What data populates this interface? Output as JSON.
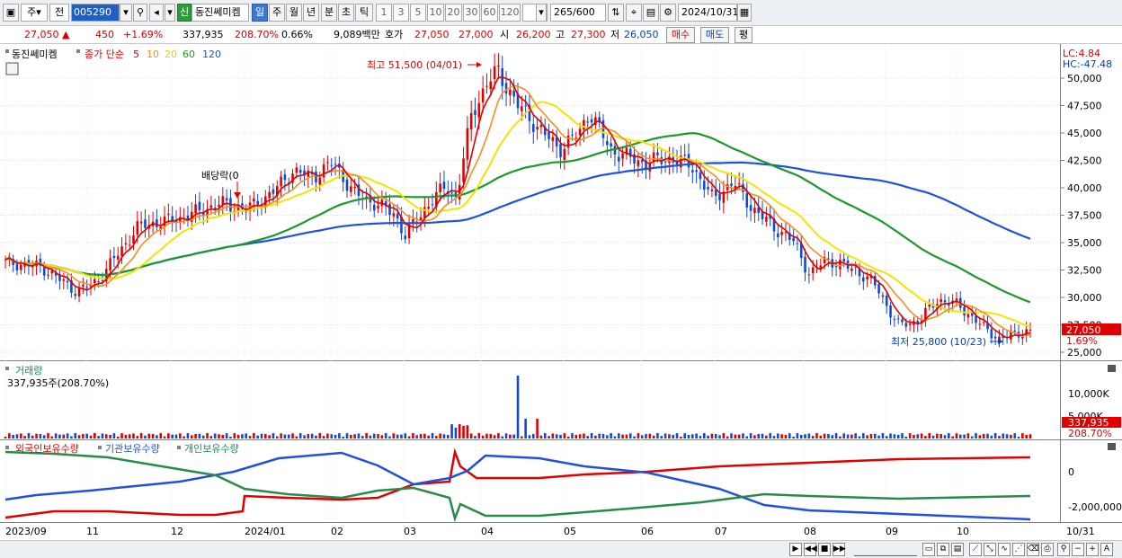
{
  "toolbar": {
    "period_main": "주",
    "period_prev": "전",
    "code": "005290",
    "credit_badge": "신",
    "stock_name": "동진쎄미켐",
    "periods": [
      "일",
      "주",
      "월",
      "년",
      "분",
      "초",
      "틱"
    ],
    "active_period": "일",
    "intervals": [
      "1",
      "3",
      "5",
      "10",
      "20",
      "30",
      "60",
      "120"
    ],
    "count": "265",
    "count_total": "/600",
    "date": "2024/10/31"
  },
  "quote": {
    "price": "27,050",
    "change": "450",
    "change_rate": "+1.69%",
    "volume": "337,935",
    "volume_ratio": "208.70%",
    "turnover": "0.66%",
    "amount": "9,089백만",
    "ask_label": "호가",
    "ask1": "27,050",
    "bid1": "27,000",
    "open_label": "시",
    "open": "26,200",
    "high_label": "고",
    "high": "27,300",
    "low_label": "저",
    "low": "26,050",
    "buy": "매수",
    "sell": "매도",
    "eval": "평"
  },
  "legend": {
    "name": "동진쎄미켐",
    "ma_title": "종가 단순",
    "ma5": "5",
    "ma10": "10",
    "ma20": "20",
    "ma60": "60",
    "ma120": "120",
    "lc": "LC:4.84",
    "hc": "HC:-47.48"
  },
  "price_axis": [
    "50,000",
    "47,500",
    "45,000",
    "42,500",
    "40,000",
    "37,500",
    "35,000",
    "32,500",
    "30,000",
    "27,500",
    "25,000"
  ],
  "current_price_tag": "27,050",
  "current_pct_tag": "1.69%",
  "annotations": {
    "high": "최고 51,500 (04/01)",
    "low": "최저 25,800 (10/23)",
    "dividend": "배당락(0"
  },
  "volume_panel": {
    "title": "거래량",
    "value": "337,935주(208.70%)",
    "axis": [
      "10,000K",
      "5,000K"
    ],
    "tag_value": "337,935",
    "tag_pct": "208.70%"
  },
  "holdings_panel": {
    "title_foreign": "외국인보유수량",
    "title_inst": "기관보유수량",
    "title_indiv": "개인보유수량",
    "axis": [
      "0",
      "-2,000,000"
    ]
  },
  "date_axis": [
    "2023/09",
    "11",
    "12",
    "2024/01",
    "02",
    "03",
    "04",
    "05",
    "06",
    "07",
    "08",
    "09",
    "10",
    "10/31"
  ],
  "colors": {
    "up": "#e00000",
    "down": "#1048d8",
    "ma5": "#e00000",
    "ma10": "#ff8c1a",
    "ma20": "#f4e400",
    "ma60": "#1a9a2a",
    "ma120": "#2050e0"
  }
}
